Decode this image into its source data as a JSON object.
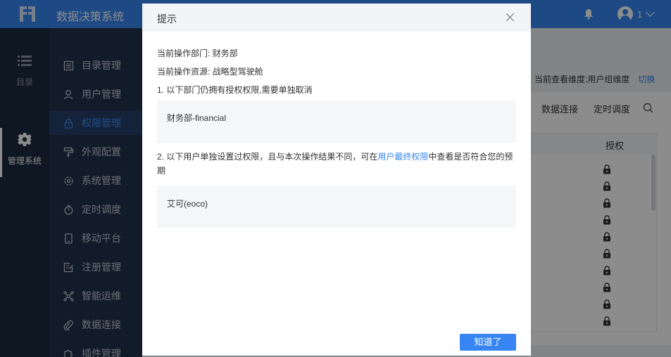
{
  "app": {
    "title": "数据决策系统",
    "user_name": "1"
  },
  "rail": {
    "items": [
      {
        "label": "目录",
        "icon": "list-icon"
      },
      {
        "label": "管理系统",
        "icon": "gear-icon"
      }
    ]
  },
  "menu": {
    "items": [
      {
        "label": "目录管理",
        "icon": "catalog-icon"
      },
      {
        "label": "用户管理",
        "icon": "user-icon"
      },
      {
        "label": "权限管理",
        "icon": "lock-icon"
      },
      {
        "label": "外观配置",
        "icon": "paint-roller-icon"
      },
      {
        "label": "系统管理",
        "icon": "settings-icon"
      },
      {
        "label": "定时调度",
        "icon": "timer-icon"
      },
      {
        "label": "移动平台",
        "icon": "mobile-icon"
      },
      {
        "label": "注册管理",
        "icon": "register-icon"
      },
      {
        "label": "智能运维",
        "icon": "network-icon"
      },
      {
        "label": "数据连接",
        "icon": "link-icon"
      },
      {
        "label": "插件管理",
        "icon": "plugin-icon"
      }
    ],
    "active": "权限管理"
  },
  "background": {
    "view_label": "当前查看维度:用户组维度",
    "switch_label": "切换",
    "tabs": [
      "数据连接",
      "定时调度"
    ],
    "column_header": "授权"
  },
  "dialog": {
    "title": "提示",
    "dept_line": "当前操作部门: 财务部",
    "resource_line": "当前操作资源: 战略型驾驶舱",
    "section1": "1. 以下部门仍拥有授权权限,需要单独取消",
    "section1_item": "财务部-financial",
    "section2_before": "2. 以下用户单独设置过权限，且与本次操作结果不同，可在",
    "section2_link": "用户最终权限",
    "section2_after": "中查看是否符合您的预期",
    "section2_item": "艾可(eoco)",
    "ok_button": "知道了"
  },
  "colors": {
    "topbar": "#3685f2",
    "rail": "#1c2a41",
    "menu": "#22324c",
    "accent": "#3685f2"
  }
}
